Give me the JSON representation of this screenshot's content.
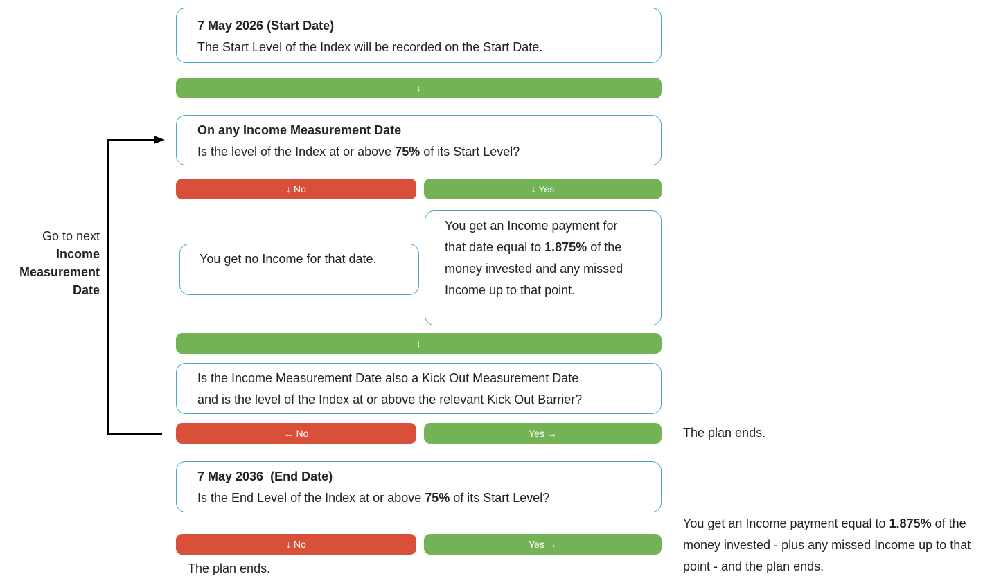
{
  "start_box": {
    "title": "7 May 2026 (Start Date)",
    "text": "The Start Level of the Index will be recorded on the Start Date."
  },
  "bar1": {
    "label": "↓"
  },
  "income_question": {
    "title": "On any Income Measurement Date",
    "text_before": "Is the level of the Index at or above ",
    "bold_value": "75%",
    "text_after": " of its Start Level?"
  },
  "income_no": {
    "label": "↓ No"
  },
  "income_yes": {
    "label": "↓ Yes"
  },
  "no_income_box": {
    "text": "You get no Income for that date."
  },
  "income_box": {
    "text_before": "You get an Income payment for that date equal to ",
    "bold_value": "1.875%",
    "text_after": " of the money invested and any missed Income up to that point."
  },
  "bar2": {
    "label": "↓"
  },
  "kickout_question": {
    "line1": "Is the Income Measurement Date also a Kick Out Measurement Date",
    "line2": "and is the level of the Index at or above the relevant Kick Out Barrier?"
  },
  "kickout_no": {
    "label": "← No"
  },
  "kickout_yes": {
    "label": "Yes →"
  },
  "kickout_result": {
    "text": "The plan ends."
  },
  "side_note": {
    "line1": "Go to next",
    "line2": "Income",
    "line3": "Measurement",
    "line4": "Date"
  },
  "end_question": {
    "title": "7 May 2036  (End Date)",
    "text_before": "Is the End Level of the Index at or above ",
    "bold_value": "75%",
    "text_after": " of its Start Level?"
  },
  "end_no": {
    "label": "↓ No"
  },
  "end_yes": {
    "label": "Yes →"
  },
  "end_no_result": {
    "text": "The plan ends."
  },
  "end_yes_result": {
    "text_before": "You get an Income payment equal to ",
    "bold_value": "1.875%",
    "text_after": " of the money invested - plus any missed Income up to that point - and the plan ends."
  },
  "colors": {
    "box_border": "#4aa8cf",
    "green": "#73b355",
    "red": "#d9503a",
    "arrow": "#000000"
  }
}
